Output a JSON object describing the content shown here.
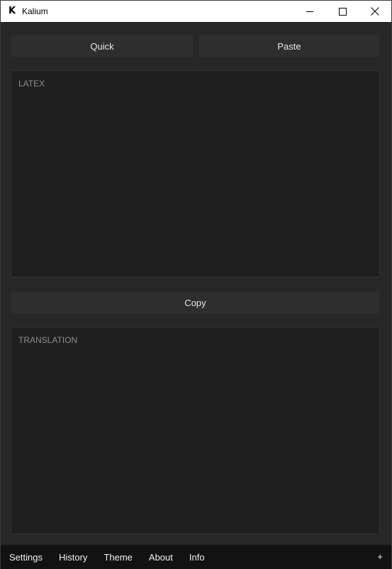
{
  "window": {
    "title": "Kalium",
    "icon_letter": "K"
  },
  "toolbar": {
    "quick_label": "Quick",
    "paste_label": "Paste"
  },
  "latex_panel": {
    "placeholder": "LATEX"
  },
  "copy_label": "Copy",
  "translation_panel": {
    "placeholder": "TRANSLATION"
  },
  "nav": {
    "items": [
      "Settings",
      "History",
      "Theme",
      "About",
      "Info"
    ],
    "add_label": "+"
  },
  "colors": {
    "background": "#272727",
    "panel": "#1f1f1f",
    "button": "#2e2e2e",
    "bottom_bar": "#121212",
    "title_bar": "#ffffff"
  },
  "icons": {
    "minimize": "minimize-icon",
    "maximize": "maximize-icon",
    "close": "close-icon"
  }
}
